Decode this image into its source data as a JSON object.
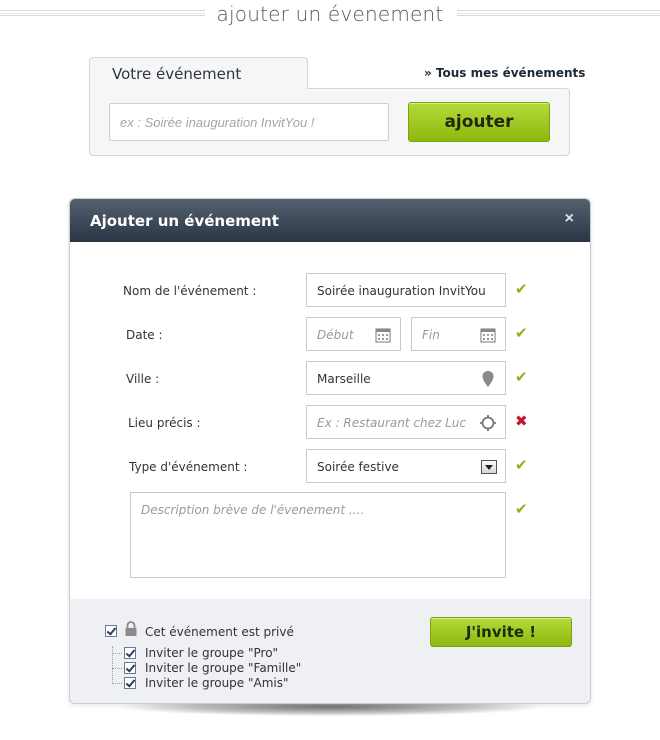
{
  "page": {
    "title": "ajouter un évenement"
  },
  "event_box": {
    "tab_label": "Votre événement",
    "all_events_link": "» Tous mes événements",
    "input_placeholder": "ex : Soirée inauguration InvitYou !",
    "add_button": "ajouter"
  },
  "modal": {
    "title": "Ajouter un événement",
    "close": "×",
    "fields": {
      "name": {
        "label": "Nom de l'événement :",
        "value": "Soirée inauguration InvitYou",
        "status": "✔"
      },
      "date": {
        "label": "Date :",
        "start_placeholder": "Début",
        "end_placeholder": "Fin",
        "status": "✔"
      },
      "city": {
        "label": "Ville :",
        "value": "Marseille",
        "status": "✔"
      },
      "place": {
        "label": "Lieu précis :",
        "placeholder": "Ex : Restaurant chez Luc",
        "status": "✖"
      },
      "type": {
        "label": "Type d'événement :",
        "value": "Soirée festive",
        "status": "✔"
      },
      "description": {
        "placeholder": "Description brève de l'évenement ....",
        "status": "✔"
      }
    },
    "footer": {
      "private_label": "Cet événement est privé",
      "groups": [
        "Inviter le groupe \"Pro\"",
        "Inviter le groupe \"Famille\"",
        "Inviter le groupe \"Amis\""
      ],
      "invite_button": "J'invite !"
    }
  },
  "colors": {
    "accent_green": "#9cc41f",
    "header_dark": "#2b3643",
    "error_red": "#c8102e"
  }
}
